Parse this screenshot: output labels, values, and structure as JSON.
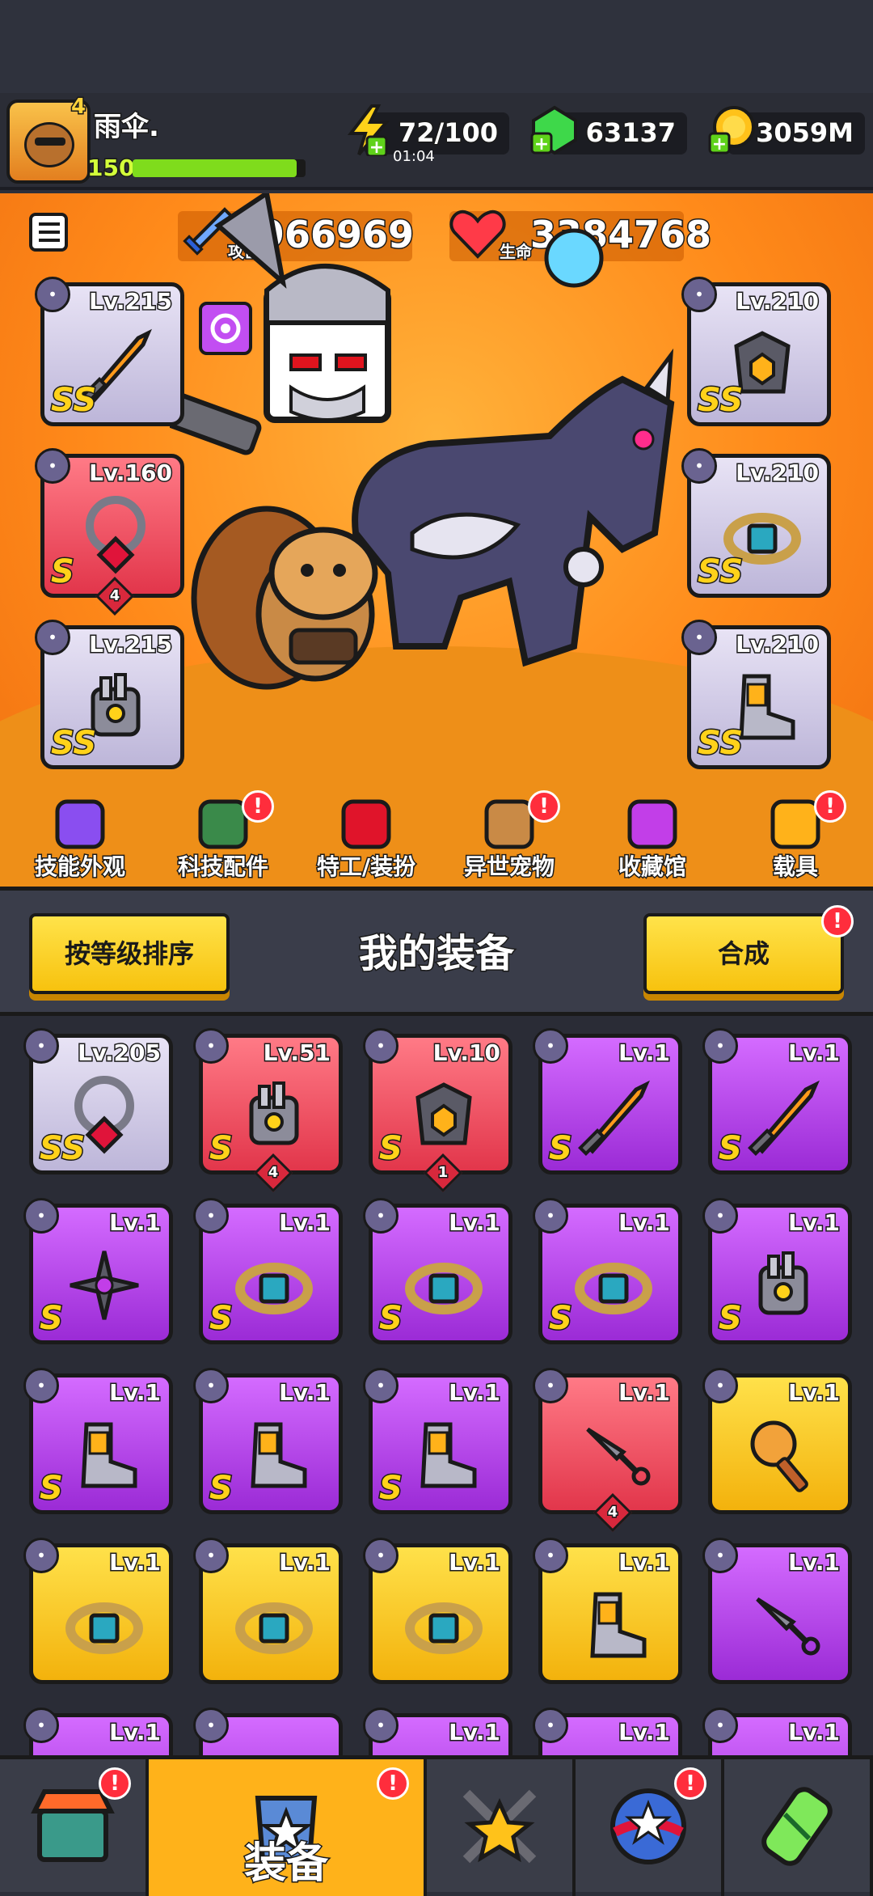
{
  "player": {
    "name": "雨伞.",
    "avatar_badge": "4",
    "level": "150",
    "xp_fraction": 0.95
  },
  "resources": {
    "energy": "72/100",
    "energy_timer": "01:04",
    "gems": "63137",
    "gold": "3059M"
  },
  "stats": {
    "attack_label": "攻击",
    "attack_value": "966969",
    "hp_label": "生命",
    "hp_value": "3384768"
  },
  "equipped": {
    "left": [
      {
        "level": "Lv.215",
        "rank": "SS",
        "rarity": "grey",
        "icon": "sword-icon"
      },
      {
        "level": "Lv.160",
        "rank": "S",
        "rarity": "red",
        "icon": "necklace-icon",
        "stars": "4"
      },
      {
        "level": "Lv.215",
        "rank": "SS",
        "rarity": "grey",
        "icon": "gauntlet-icon"
      }
    ],
    "right": [
      {
        "level": "Lv.210",
        "rank": "SS",
        "rarity": "grey",
        "icon": "armor-icon"
      },
      {
        "level": "Lv.210",
        "rank": "SS",
        "rarity": "grey",
        "icon": "belt-icon"
      },
      {
        "level": "Lv.210",
        "rank": "SS",
        "rarity": "grey",
        "icon": "boots-icon"
      }
    ]
  },
  "features": [
    {
      "label": "技能外观",
      "badge": false
    },
    {
      "label": "科技配件",
      "badge": true
    },
    {
      "label": "特工/装扮",
      "badge": false
    },
    {
      "label": "异世宠物",
      "badge": true
    },
    {
      "label": "收藏馆",
      "badge": false
    },
    {
      "label": "载具",
      "badge": true
    }
  ],
  "equipment_panel": {
    "sort_label": "按等级排序",
    "title": "我的装备",
    "merge_label": "合成",
    "badge": "!"
  },
  "inventory": [
    {
      "level": "Lv.205",
      "rank": "SS",
      "rarity": "grey",
      "icon": "necklace-icon"
    },
    {
      "level": "Lv.51",
      "rank": "S",
      "rarity": "red",
      "icon": "gauntlet-icon",
      "stars": "4"
    },
    {
      "level": "Lv.10",
      "rank": "S",
      "rarity": "red",
      "icon": "armor-icon",
      "stars": "1"
    },
    {
      "level": "Lv.1",
      "rank": "S",
      "rarity": "purple",
      "icon": "sword-icon"
    },
    {
      "level": "Lv.1",
      "rank": "S",
      "rarity": "purple",
      "icon": "sword-icon"
    },
    {
      "level": "Lv.1",
      "rank": "S",
      "rarity": "purple",
      "icon": "shuriken-icon"
    },
    {
      "level": "Lv.1",
      "rank": "S",
      "rarity": "purple",
      "icon": "belt-icon"
    },
    {
      "level": "Lv.1",
      "rank": "S",
      "rarity": "purple",
      "icon": "belt-icon"
    },
    {
      "level": "Lv.1",
      "rank": "S",
      "rarity": "purple",
      "icon": "belt-icon"
    },
    {
      "level": "Lv.1",
      "rank": "S",
      "rarity": "purple",
      "icon": "gauntlet-icon"
    },
    {
      "level": "Lv.1",
      "rank": "S",
      "rarity": "purple",
      "icon": "boots-icon"
    },
    {
      "level": "Lv.1",
      "rank": "S",
      "rarity": "purple",
      "icon": "boots-icon"
    },
    {
      "level": "Lv.1",
      "rank": "S",
      "rarity": "purple",
      "icon": "boots-icon"
    },
    {
      "level": "Lv.1",
      "rank": "",
      "rarity": "red",
      "icon": "kunai-icon",
      "stars": "4"
    },
    {
      "level": "Lv.1",
      "rank": "",
      "rarity": "gold",
      "icon": "club-icon"
    },
    {
      "level": "Lv.1",
      "rank": "",
      "rarity": "gold",
      "icon": "belt-icon"
    },
    {
      "level": "Lv.1",
      "rank": "",
      "rarity": "gold",
      "icon": "belt-icon"
    },
    {
      "level": "Lv.1",
      "rank": "",
      "rarity": "gold",
      "icon": "belt-icon"
    },
    {
      "level": "Lv.1",
      "rank": "",
      "rarity": "gold",
      "icon": "boots-icon"
    },
    {
      "level": "Lv.1",
      "rank": "",
      "rarity": "purple",
      "icon": "kunai-icon"
    },
    {
      "level": "Lv.1",
      "rank": "",
      "rarity": "purple",
      "icon": "sword-icon"
    },
    {
      "level": "",
      "rank": "",
      "rarity": "purple",
      "icon": "sword-icon"
    },
    {
      "level": "Lv.1",
      "rank": "",
      "rarity": "purple",
      "icon": "sword-icon"
    },
    {
      "level": "Lv.1",
      "rank": "",
      "rarity": "purple",
      "icon": "sword-icon"
    },
    {
      "level": "Lv.1",
      "rank": "",
      "rarity": "purple",
      "icon": "sword-icon"
    }
  ],
  "bottom_nav": [
    {
      "name": "shop",
      "icon": "shop-icon",
      "badge": true
    },
    {
      "name": "equipment",
      "label": "装备",
      "icon": "equipment-icon",
      "badge": true
    },
    {
      "name": "battle",
      "icon": "crossed-swords-icon",
      "badge": false
    },
    {
      "name": "gacha",
      "icon": "star-orb-icon",
      "badge": true
    },
    {
      "name": "evolve",
      "icon": "dna-icon",
      "badge": false
    }
  ],
  "colors": {
    "grey": "#d8d2ee",
    "red": "#f04a5a",
    "purple": "#b845f0",
    "gold": "#ffcc1a",
    "accent": "#ffb21a"
  }
}
